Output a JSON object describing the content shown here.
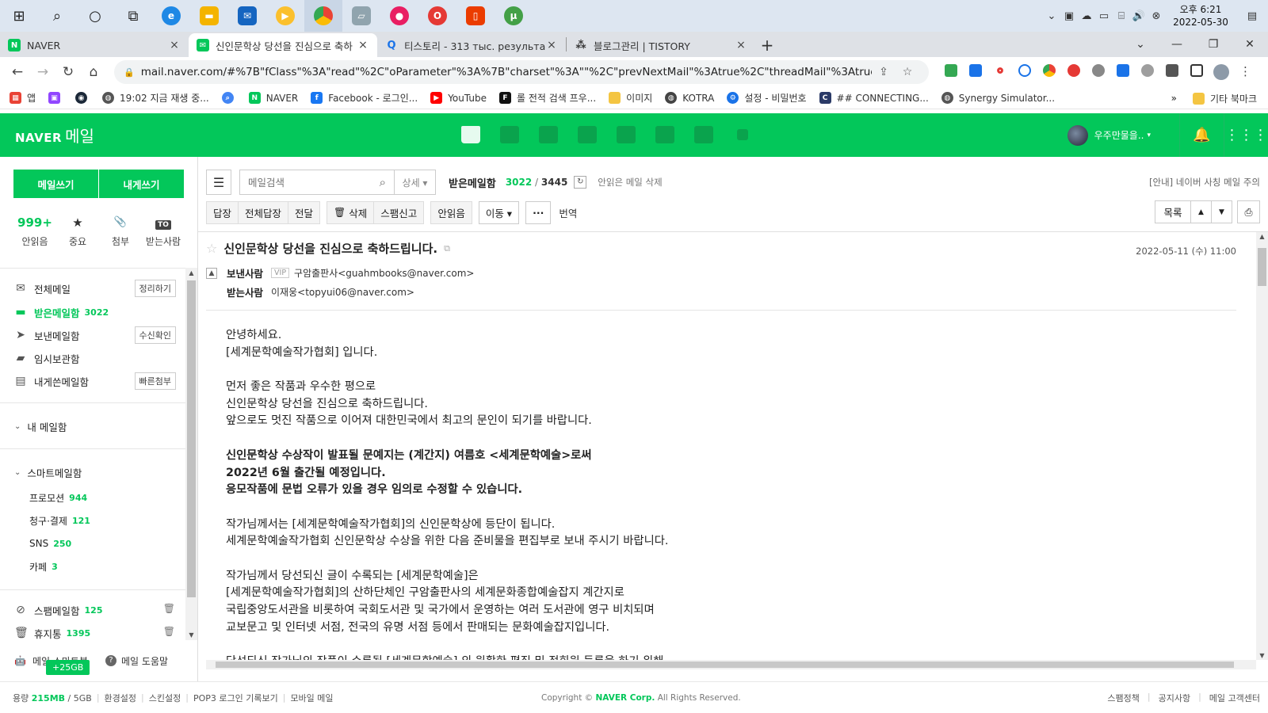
{
  "taskbar": {
    "clock_time": "오후 6:21",
    "clock_date": "2022-05-30"
  },
  "browser": {
    "tabs": [
      {
        "title": "NAVER",
        "favicon": "N",
        "color": "#03c75a"
      },
      {
        "title": "신인문학상 당선을 진심으로 축하",
        "favicon": "✉",
        "color": "#03c75a"
      },
      {
        "title": "티스토리 - 313 тыс. результато",
        "favicon": "Q",
        "color": "#1a73e8"
      },
      {
        "title": "블로그관리 | TISTORY",
        "favicon": "⁂",
        "color": "#333333"
      }
    ],
    "url": "mail.naver.com/#%7B\"fClass\"%3A\"read\"%2C\"oParameter\"%3A%7B\"charset\"%3A\"\"%2C\"prevNextMail\"%3Atrue%2C\"threadMail\"%3Atrue%2C\"fold...",
    "bookmarks": [
      {
        "label": "앱",
        "color": "#e94235"
      },
      {
        "label": "",
        "color": "#9146ff"
      },
      {
        "label": "",
        "color": "#1b2838"
      },
      {
        "label": "19:02 지금 재생 중...",
        "color": "#555555"
      },
      {
        "label": "",
        "color": "#4285f4"
      },
      {
        "label": "NAVER",
        "color": "#03c75a"
      },
      {
        "label": "Facebook - 로그인...",
        "color": "#1877f2"
      },
      {
        "label": "YouTube",
        "color": "#ff0000"
      },
      {
        "label": "롤 전적 검색 프우...",
        "color": "#111111"
      },
      {
        "label": "이미지",
        "color": "#f4c542"
      },
      {
        "label": "KOTRA",
        "color": "#444444"
      },
      {
        "label": "설정 - 비밀번호",
        "color": "#1a73e8"
      },
      {
        "label": "## CONNECTING...",
        "color": "#2b3a67"
      },
      {
        "label": "Synergy Simulator...",
        "color": "#555555"
      }
    ],
    "bookmarks_more": "»",
    "other_bookmarks": "기타 북마크"
  },
  "naver_header": {
    "logo_naver": "NAVER",
    "logo_mail": "메일",
    "user_name": "우주만물을.."
  },
  "sidebar": {
    "write_button": "메일쓰기",
    "self_write_button": "내게쓰기",
    "quick": [
      {
        "value": "999+",
        "label": "안읽음",
        "icon": "count"
      },
      {
        "value": "★",
        "label": "중요",
        "icon": "star-icon"
      },
      {
        "value": "📎",
        "label": "첨부",
        "icon": "paperclip-icon"
      },
      {
        "value": "TO",
        "label": "받는사람",
        "icon": "to-icon"
      }
    ],
    "folders": [
      {
        "label": "전체메일",
        "count": "",
        "action": "정리하기",
        "icon": "✉"
      },
      {
        "label": "받은메일함",
        "count": "3022",
        "action": "",
        "icon": "▬"
      },
      {
        "label": "보낸메일함",
        "count": "",
        "action": "수신확인",
        "icon": "➤"
      },
      {
        "label": "임시보관함",
        "count": "",
        "action": "",
        "icon": "▰"
      },
      {
        "label": "내게쓴메일함",
        "count": "",
        "action": "빠른첨부",
        "icon": "▤"
      }
    ],
    "my_mailbox": "내 메일함",
    "smart_mailbox": "스마트메일함",
    "smart_items": [
      {
        "label": "프로모션",
        "count": "944"
      },
      {
        "label": "청구·결제",
        "count": "121"
      },
      {
        "label": "SNS",
        "count": "250"
      },
      {
        "label": "카페",
        "count": "3"
      }
    ],
    "spam": {
      "label": "스팸메일함",
      "count": "125"
    },
    "trash": {
      "label": "휴지통",
      "count": "1395"
    },
    "bottom_smart": "메일 스마트봇",
    "bottom_help": "메일 도움말",
    "storage_badge": "+25GB"
  },
  "main": {
    "search_placeholder": "메일검색",
    "detail_label": "상세 ▾",
    "inbox_title": "받은메일함",
    "unread_count": "3022",
    "total_count": "3445",
    "delete_unread": "안읽은 메일 삭제",
    "notice": "[안내] 네이버 사칭 메일 주의",
    "toolbar": {
      "reply": "답장",
      "reply_all": "전체답장",
      "forward": "전달",
      "delete": "삭제",
      "spam": "스팸신고",
      "unread": "안읽음",
      "move": "이동 ▾",
      "more": "···",
      "translate": "번역",
      "list": "목록",
      "prev": "▲",
      "next": "▼",
      "print": "⎙"
    },
    "mail": {
      "subject": "신인문학상 당선을 진심으로 축하드립니다.",
      "date": "2022-05-11 (수) 11:00",
      "sender_label": "보낸사람",
      "vip": "VIP",
      "sender": "구암출판사<guahmbooks@naver.com>",
      "receiver_label": "받는사람",
      "receiver": "이재웅<topyui06@naver.com>",
      "body": [
        {
          "text": "안녕하세요.",
          "bold": false
        },
        {
          "text": "[세계문학예술작가협회] 입니다.",
          "bold": false
        },
        {
          "text": "",
          "bold": false
        },
        {
          "text": "먼저 좋은 작품과 우수한 평으로",
          "bold": false
        },
        {
          "text": "신인문학상 당선을 진심으로 축하드립니다.",
          "bold": false
        },
        {
          "text": "앞으로도 멋진 작품으로 이어져 대한민국에서 최고의 문인이 되기를 바랍니다.",
          "bold": false
        },
        {
          "text": "",
          "bold": false
        },
        {
          "text": "신인문학상 수상작이 발표될 문예지는 (계간지) 여름호 <세계문학예술>로써",
          "bold": true
        },
        {
          "text": "2022년 6월 출간될 예정입니다.",
          "bold": true
        },
        {
          "text": "응모작품에 문법 오류가 있을 경우 임의로 수정할 수 있습니다.",
          "bold": true
        },
        {
          "text": "",
          "bold": false
        },
        {
          "text": "작가님께서는 [세계문학예술작가협회]의 신인문학상에 등단이 됩니다.",
          "bold": false
        },
        {
          "text": "세계문학예술작가협회 신인문학상 수상을 위한 다음 준비물을 편집부로 보내 주시기 바랍니다.",
          "bold": false
        },
        {
          "text": "",
          "bold": false
        },
        {
          "text": "작가님께서 당선되신 글이 수록되는 [세계문학예술]은",
          "bold": false
        },
        {
          "text": "[세계문학예술작가협회]의 산하단체인 구암출판사의 세계문화종합예술잡지 계간지로",
          "bold": false
        },
        {
          "text": "국립중앙도서관을 비롯하여 국회도서관 및 국가에서 운영하는 여러 도서관에 영구 비치되며",
          "bold": false
        },
        {
          "text": "교보문고 및 인터넷 서점, 전국의 유명 서점 등에서 판매되는 문화예술잡지입니다.",
          "bold": false
        },
        {
          "text": "",
          "bold": false
        },
        {
          "text": "당선되신 작가님의 작품이 수록될 [세계문학예술] 의 원활한 편집 및 정회원 등록을 하기 위해",
          "bold": false
        }
      ]
    }
  },
  "footer": {
    "storage_label": "용량",
    "storage_used": "215MB",
    "storage_total": "/ 5GB",
    "links": [
      "환경설정",
      "스킨설정",
      "POP3 로그인 기록보기",
      "모바일 메일"
    ],
    "copyright_pre": "Copyright ©",
    "copyright_corp": "NAVER Corp.",
    "copyright_post": "All Rights Reserved.",
    "right_links": [
      "스팸정책",
      "공지사항",
      "메일 고객센터"
    ]
  }
}
